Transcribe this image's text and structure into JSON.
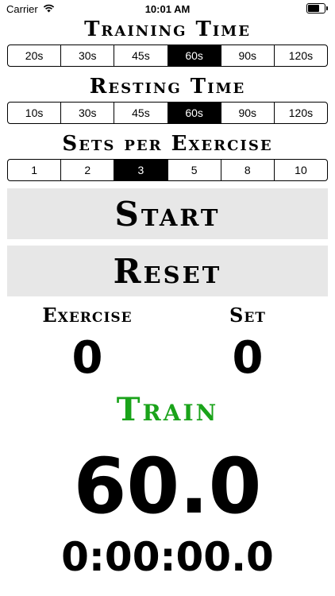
{
  "status_bar": {
    "carrier": "Carrier",
    "time": "10:01 AM",
    "battery_level": 0.8
  },
  "training_time": {
    "title": "Training Time",
    "options": [
      "20s",
      "30s",
      "45s",
      "60s",
      "90s",
      "120s"
    ],
    "selected": "60s"
  },
  "resting_time": {
    "title": "Resting Time",
    "options": [
      "10s",
      "30s",
      "45s",
      "60s",
      "90s",
      "120s"
    ],
    "selected": "60s"
  },
  "sets_per_exercise": {
    "title": "Sets per Exercise",
    "options": [
      "1",
      "2",
      "3",
      "5",
      "8",
      "10"
    ],
    "selected": "3"
  },
  "buttons": {
    "start": "Start",
    "reset": "Reset"
  },
  "counters": {
    "exercise_label": "Exercise",
    "exercise_value": "0",
    "set_label": "Set",
    "set_value": "0"
  },
  "phase": {
    "label": "Train",
    "color": "#1aa31a"
  },
  "timer": {
    "countdown": "60.0",
    "elapsed": "0:00:00.0"
  },
  "colors": {
    "selected_segment": "#000000",
    "button_bg": "#e7e7e7"
  }
}
